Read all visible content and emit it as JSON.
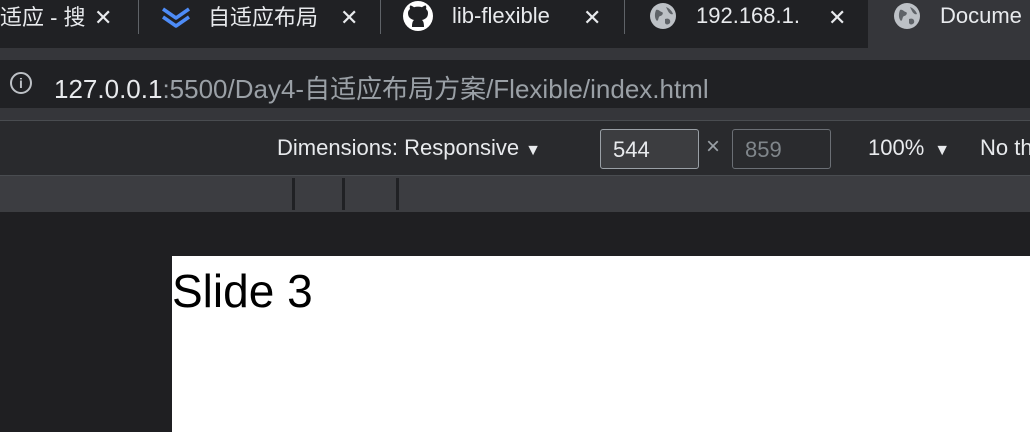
{
  "tabs": [
    {
      "title": "适应 - 搜",
      "icon": "none"
    },
    {
      "title": "自适应布局",
      "icon": "layers-icon"
    },
    {
      "title": "lib-flexible",
      "icon": "github-icon"
    },
    {
      "title": "192.168.1.",
      "icon": "globe-icon"
    },
    {
      "title": "Docume",
      "icon": "globe-icon",
      "active": true
    }
  ],
  "omnibox": {
    "host": "127.0.0.1",
    "rest": ":5500/Day4-自适应布局方案/Flexible/index.html"
  },
  "device_toolbar": {
    "dimensions_label": "Dimensions: Responsive",
    "width_value": "544",
    "times": "×",
    "height_value": "859",
    "zoom": "100%",
    "throttle": "No th"
  },
  "page": {
    "slide_text": "Slide 3"
  },
  "colors": {
    "chrome_dark": "#202124",
    "chrome_mid": "#35363a",
    "page_bg": "#ffffff"
  }
}
